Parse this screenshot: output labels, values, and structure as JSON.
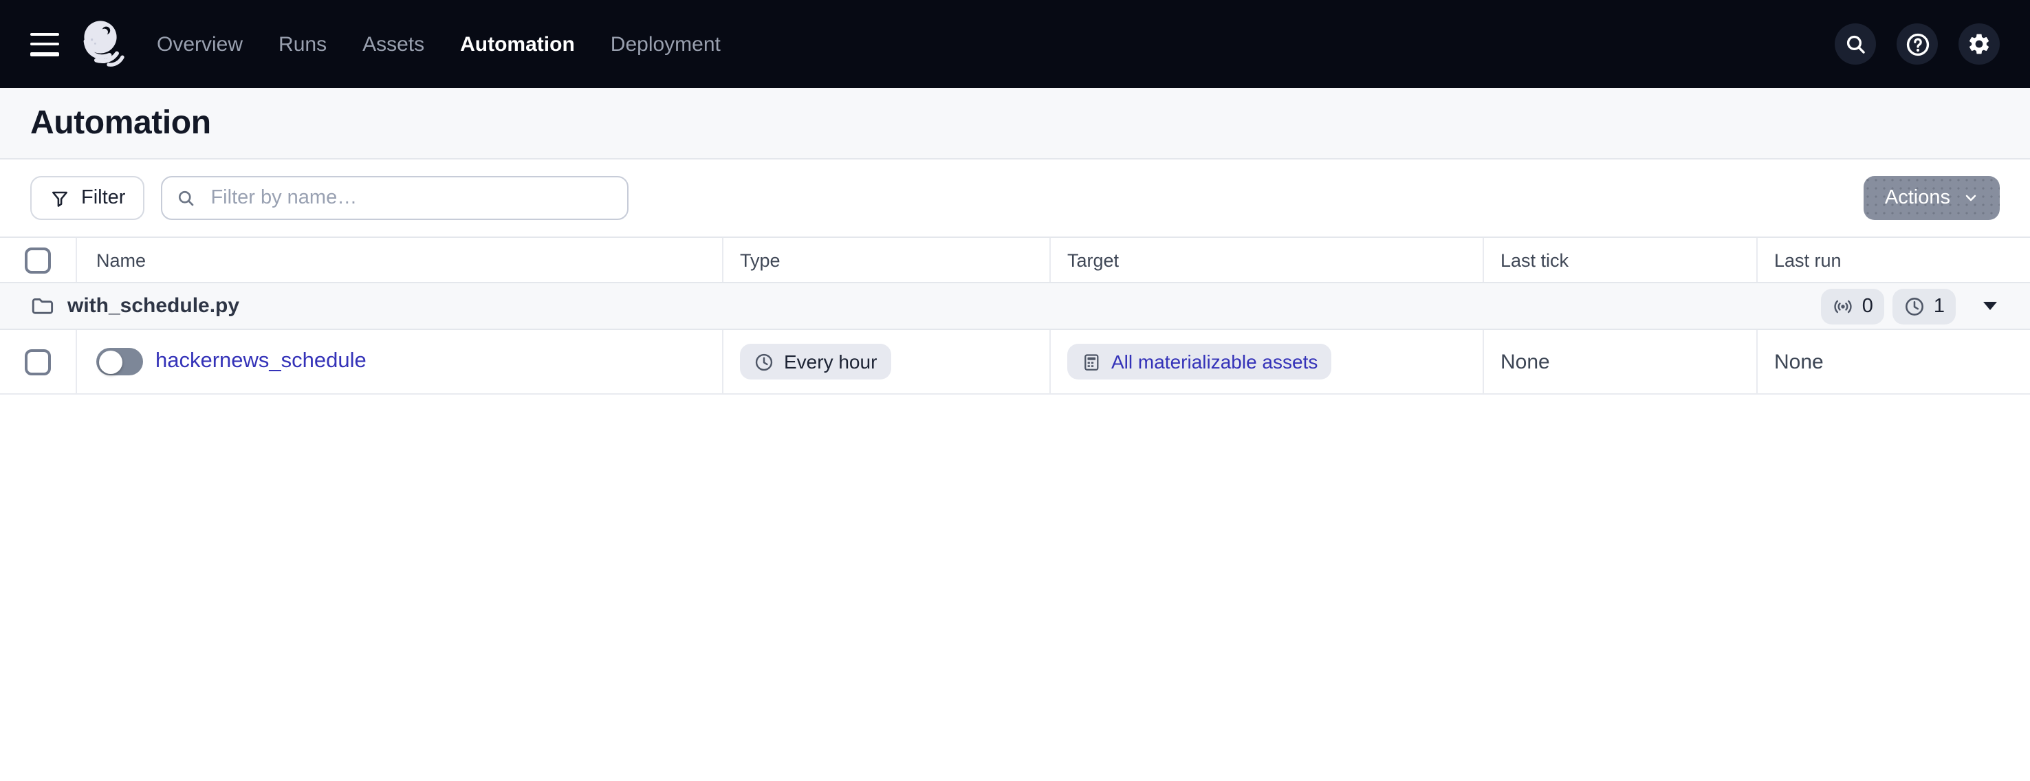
{
  "topbar": {
    "nav": [
      {
        "label": "Overview",
        "active": false
      },
      {
        "label": "Runs",
        "active": false
      },
      {
        "label": "Assets",
        "active": false
      },
      {
        "label": "Automation",
        "active": true
      },
      {
        "label": "Deployment",
        "active": false
      }
    ]
  },
  "page": {
    "title": "Automation"
  },
  "toolbar": {
    "filter_label": "Filter",
    "search_placeholder": "Filter by name…",
    "search_value": "",
    "actions_label": "Actions"
  },
  "table": {
    "columns": {
      "name": "Name",
      "type": "Type",
      "target": "Target",
      "last_tick": "Last tick",
      "last_run": "Last run"
    },
    "group": {
      "name": "with_schedule.py",
      "sensor_count": "0",
      "schedule_count": "1"
    },
    "rows": [
      {
        "name": "hackernews_schedule",
        "type": "Every hour",
        "target": "All materializable assets",
        "last_tick": "None",
        "last_run": "None",
        "enabled": false
      }
    ]
  },
  "colors": {
    "topbar_bg": "#070a14",
    "band_bg": "#f7f8fa",
    "link": "#3432b8",
    "chip_bg": "#e7e9f0",
    "actions_button_bg": "#878e9e"
  }
}
